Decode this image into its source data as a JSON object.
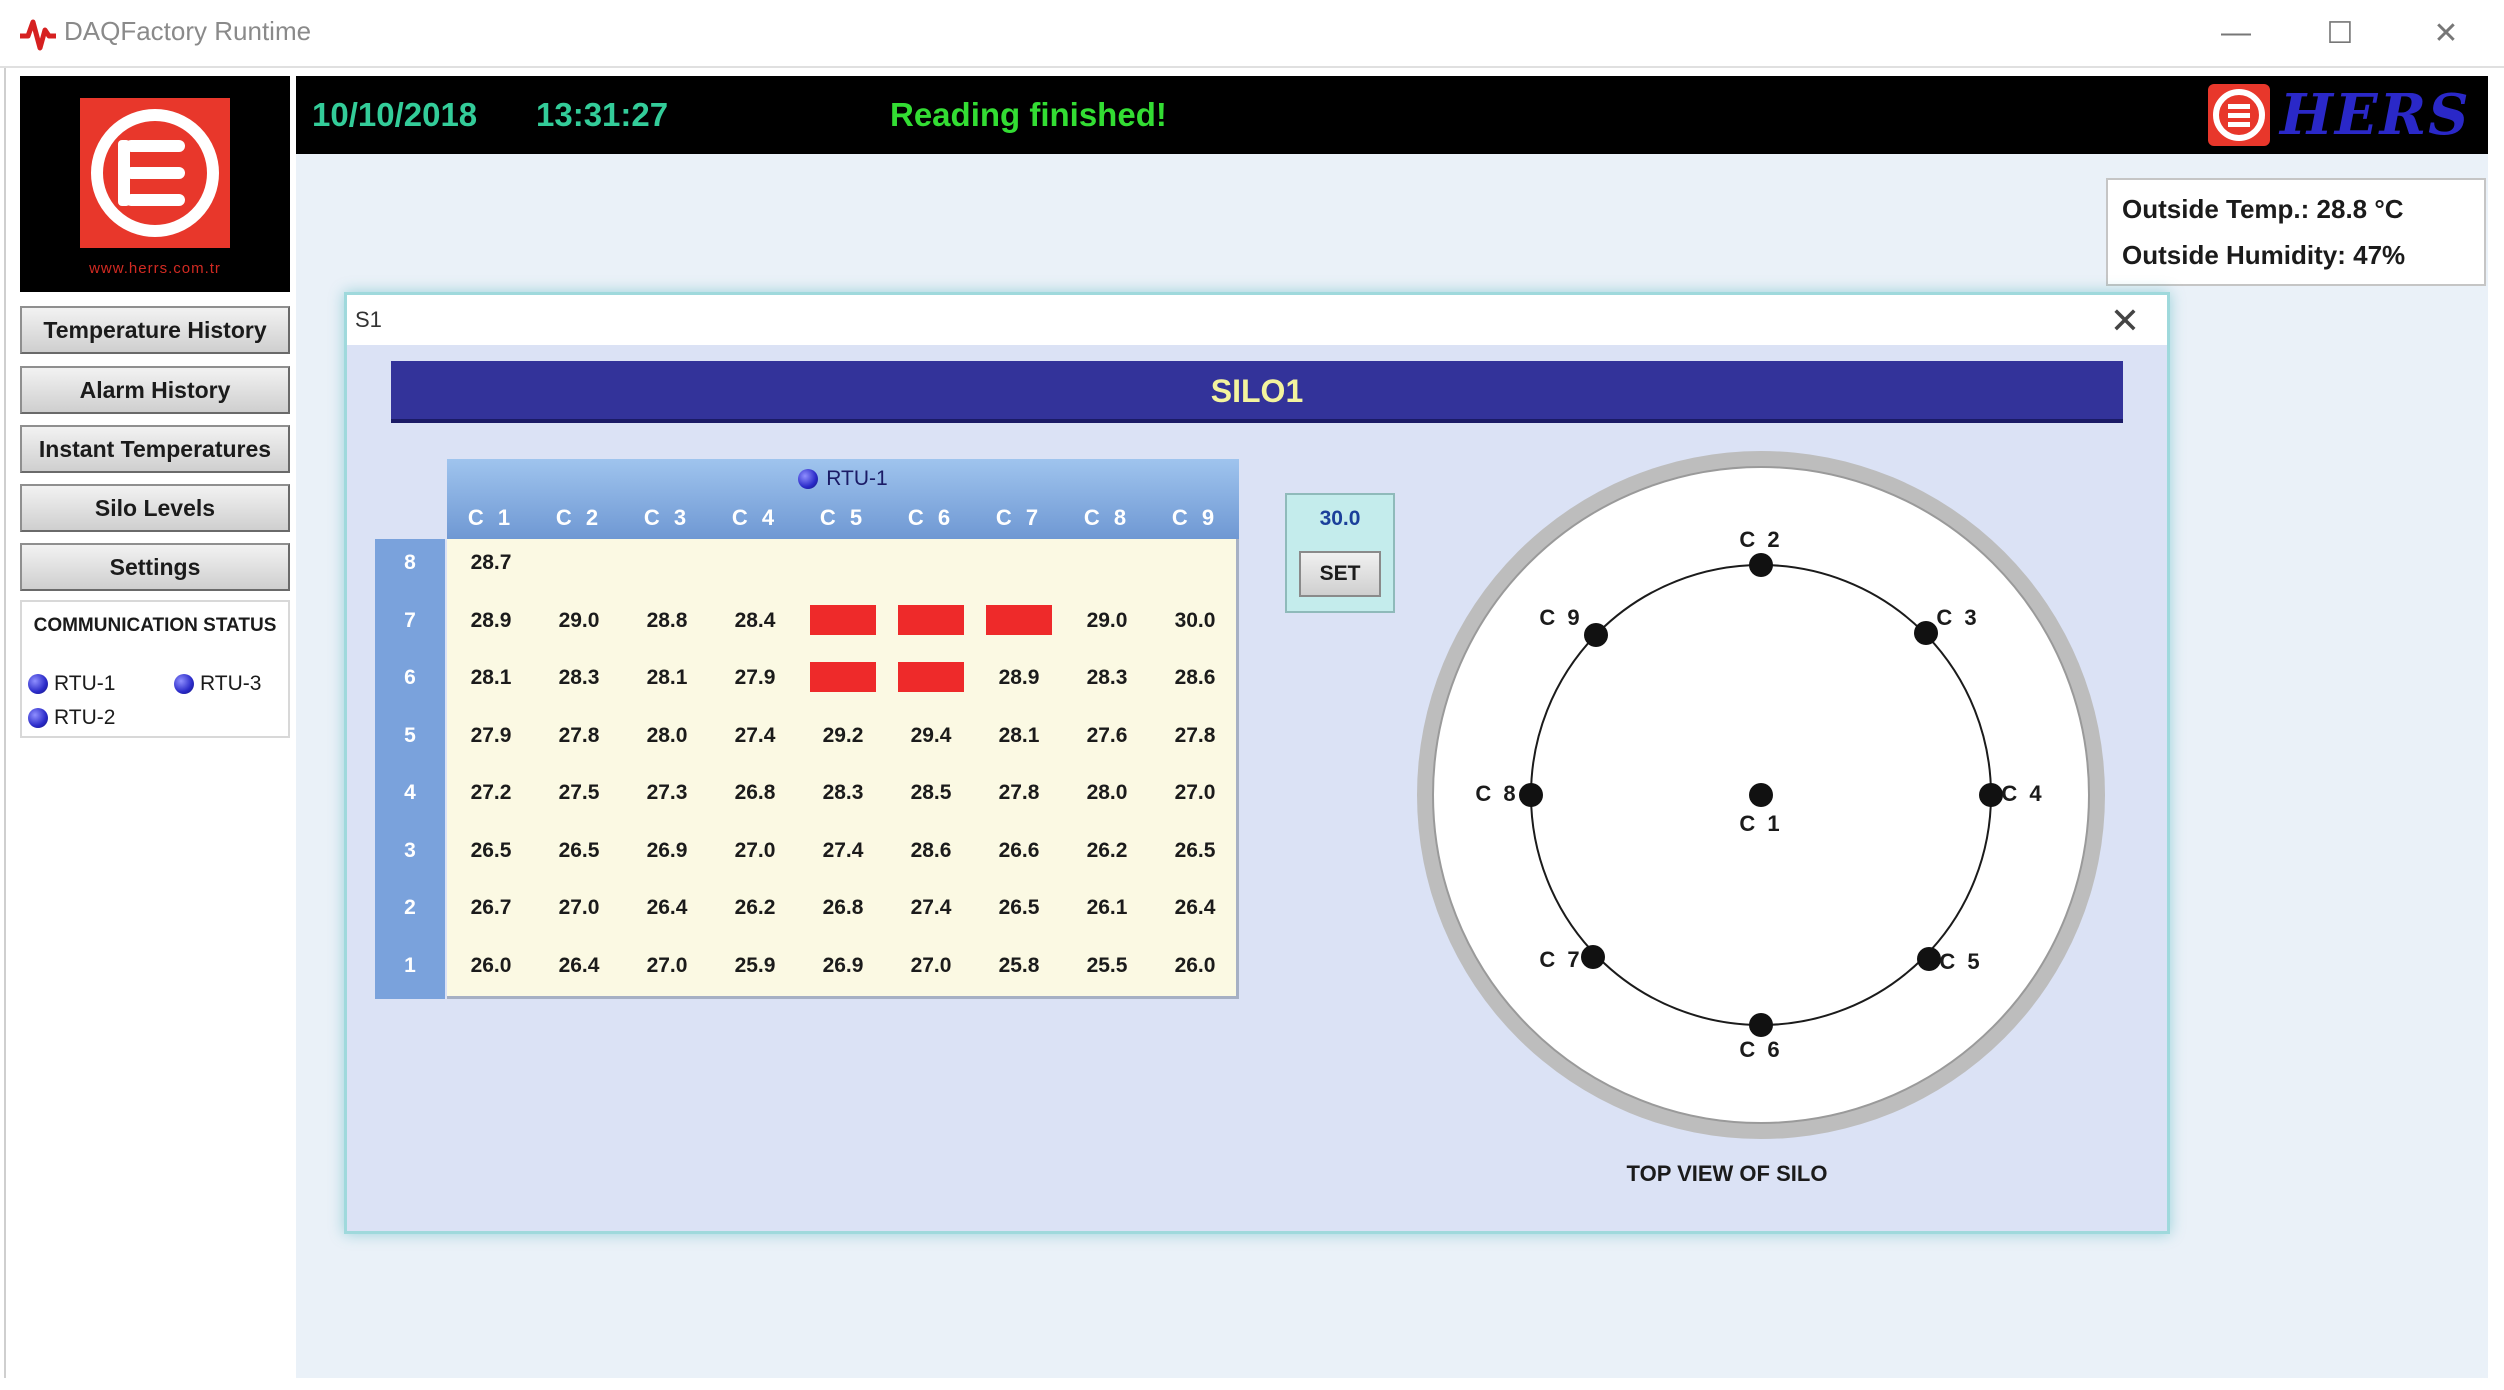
{
  "window": {
    "title": "DAQFactory Runtime",
    "controls": {
      "minimize": "—",
      "maximize": "☐",
      "close": "✕"
    }
  },
  "left_panel": {
    "logo_url_text": "www.herrs.com.tr",
    "nav": [
      {
        "label": "Temperature History"
      },
      {
        "label": "Alarm History"
      },
      {
        "label": "Instant Temperatures"
      },
      {
        "label": "Silo Levels"
      },
      {
        "label": "Settings"
      }
    ],
    "comm_status": {
      "title": "COMMUNICATION STATUS",
      "rtus": [
        {
          "label": "RTU-1"
        },
        {
          "label": "RTU-3"
        },
        {
          "label": "RTU-2"
        }
      ]
    }
  },
  "status_bar": {
    "date": "10/10/2018",
    "time": "13:31:27",
    "message": "Reading finished!",
    "brand": "HERS",
    "colors": {
      "date": "#33cc99",
      "time": "#33cc99",
      "message": "#33dd33"
    }
  },
  "outside": {
    "temp": "Outside Temp.: 28.8 °C",
    "humidity": "Outside Humidity: 47%"
  },
  "dialog": {
    "title": "S1",
    "close": "✕",
    "silo_title": "SILO1",
    "rtu_label": "RTU-1",
    "columns": [
      "C 1",
      "C 2",
      "C 3",
      "C 4",
      "C 5",
      "C 6",
      "C 7",
      "C 8",
      "C 9"
    ],
    "rows": [
      {
        "label": "8",
        "cells": [
          "28.7",
          "",
          "",
          "",
          "",
          "",
          "",
          "",
          ""
        ]
      },
      {
        "label": "7",
        "cells": [
          "28.9",
          "29.0",
          "28.8",
          "28.4",
          "",
          "",
          "",
          "29.0",
          "30.0"
        ]
      },
      {
        "label": "6",
        "cells": [
          "28.1",
          "28.3",
          "28.1",
          "27.9",
          "",
          "",
          "28.9",
          "28.3",
          "28.6"
        ]
      },
      {
        "label": "5",
        "cells": [
          "27.9",
          "27.8",
          "28.0",
          "27.4",
          "29.2",
          "29.4",
          "28.1",
          "27.6",
          "27.8"
        ]
      },
      {
        "label": "4",
        "cells": [
          "27.2",
          "27.5",
          "27.3",
          "26.8",
          "28.3",
          "28.5",
          "27.8",
          "28.0",
          "27.0"
        ]
      },
      {
        "label": "3",
        "cells": [
          "26.5",
          "26.5",
          "26.9",
          "27.0",
          "27.4",
          "28.6",
          "26.6",
          "26.2",
          "26.5"
        ]
      },
      {
        "label": "2",
        "cells": [
          "26.7",
          "27.0",
          "26.4",
          "26.2",
          "26.8",
          "27.4",
          "26.5",
          "26.1",
          "26.4"
        ]
      },
      {
        "label": "1",
        "cells": [
          "26.0",
          "26.4",
          "27.0",
          "25.9",
          "26.9",
          "27.0",
          "25.8",
          "25.5",
          "26.0"
        ]
      }
    ],
    "alarms": [
      {
        "row": 1,
        "col": 4
      },
      {
        "row": 1,
        "col": 5
      },
      {
        "row": 1,
        "col": 6
      },
      {
        "row": 2,
        "col": 4
      },
      {
        "row": 2,
        "col": 5
      }
    ],
    "alarm_color": "#ee2a2a",
    "setpoint": {
      "value": "30.0",
      "button": "SET"
    },
    "top_view": {
      "label": "TOP VIEW OF SILO",
      "sensors": [
        "C 1",
        "C 2",
        "C 3",
        "C 4",
        "C 5",
        "C 6",
        "C 7",
        "C 8",
        "C 9"
      ]
    }
  }
}
